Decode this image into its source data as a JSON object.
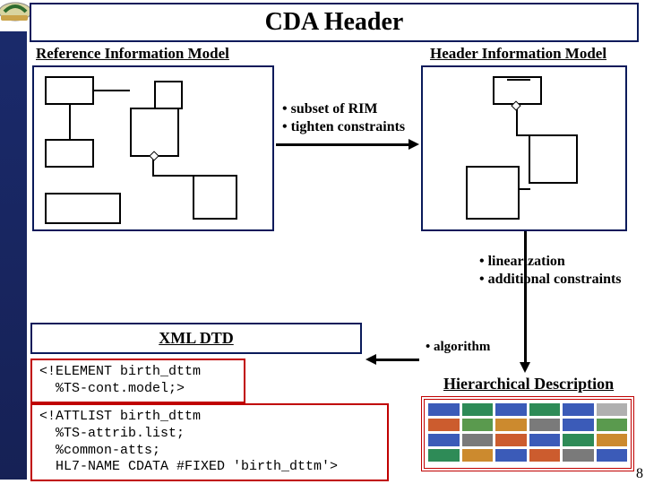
{
  "title": "CDA Header",
  "panels": {
    "rim": {
      "title": "Reference Information Model"
    },
    "him": {
      "title": "Header Information Model"
    }
  },
  "bullets": {
    "rim_to_him": "• subset of RIM\n• tighten constraints",
    "him_to_hd": "• linearization\n• additional constraints",
    "hd_to_xml": "• algorithm"
  },
  "hd": {
    "title": "Hierarchical Description"
  },
  "xml": {
    "title": "XML DTD",
    "block1": "<!ELEMENT birth_dttm\n  %TS-cont.model;>",
    "block2": "<!ATTLIST birth_dttm\n  %TS-attrib.list;\n  %common-atts;\n  HL7-NAME CDATA #FIXED 'birth_dttm'>"
  },
  "colors": {
    "row1": [
      "#3b5bb8",
      "#2e8b57",
      "#3b5bb8",
      "#2e8b57",
      "#3b5bb8",
      "#b0b0b0"
    ],
    "row2": [
      "#cc5c2e",
      "#5a9a4e",
      "#cc8a2e",
      "#7a7a7a",
      "#3b5bb8",
      "#5a9a4e"
    ],
    "row3": [
      "#3b5bb8",
      "#7a7a7a",
      "#cc5c2e",
      "#3b5bb8",
      "#2e8b57",
      "#cc8a2e"
    ],
    "row4": [
      "#2e8b57",
      "#cc8a2e",
      "#3b5bb8",
      "#cc5c2e",
      "#7a7a7a",
      "#3b5bb8"
    ]
  },
  "page_number": "8"
}
